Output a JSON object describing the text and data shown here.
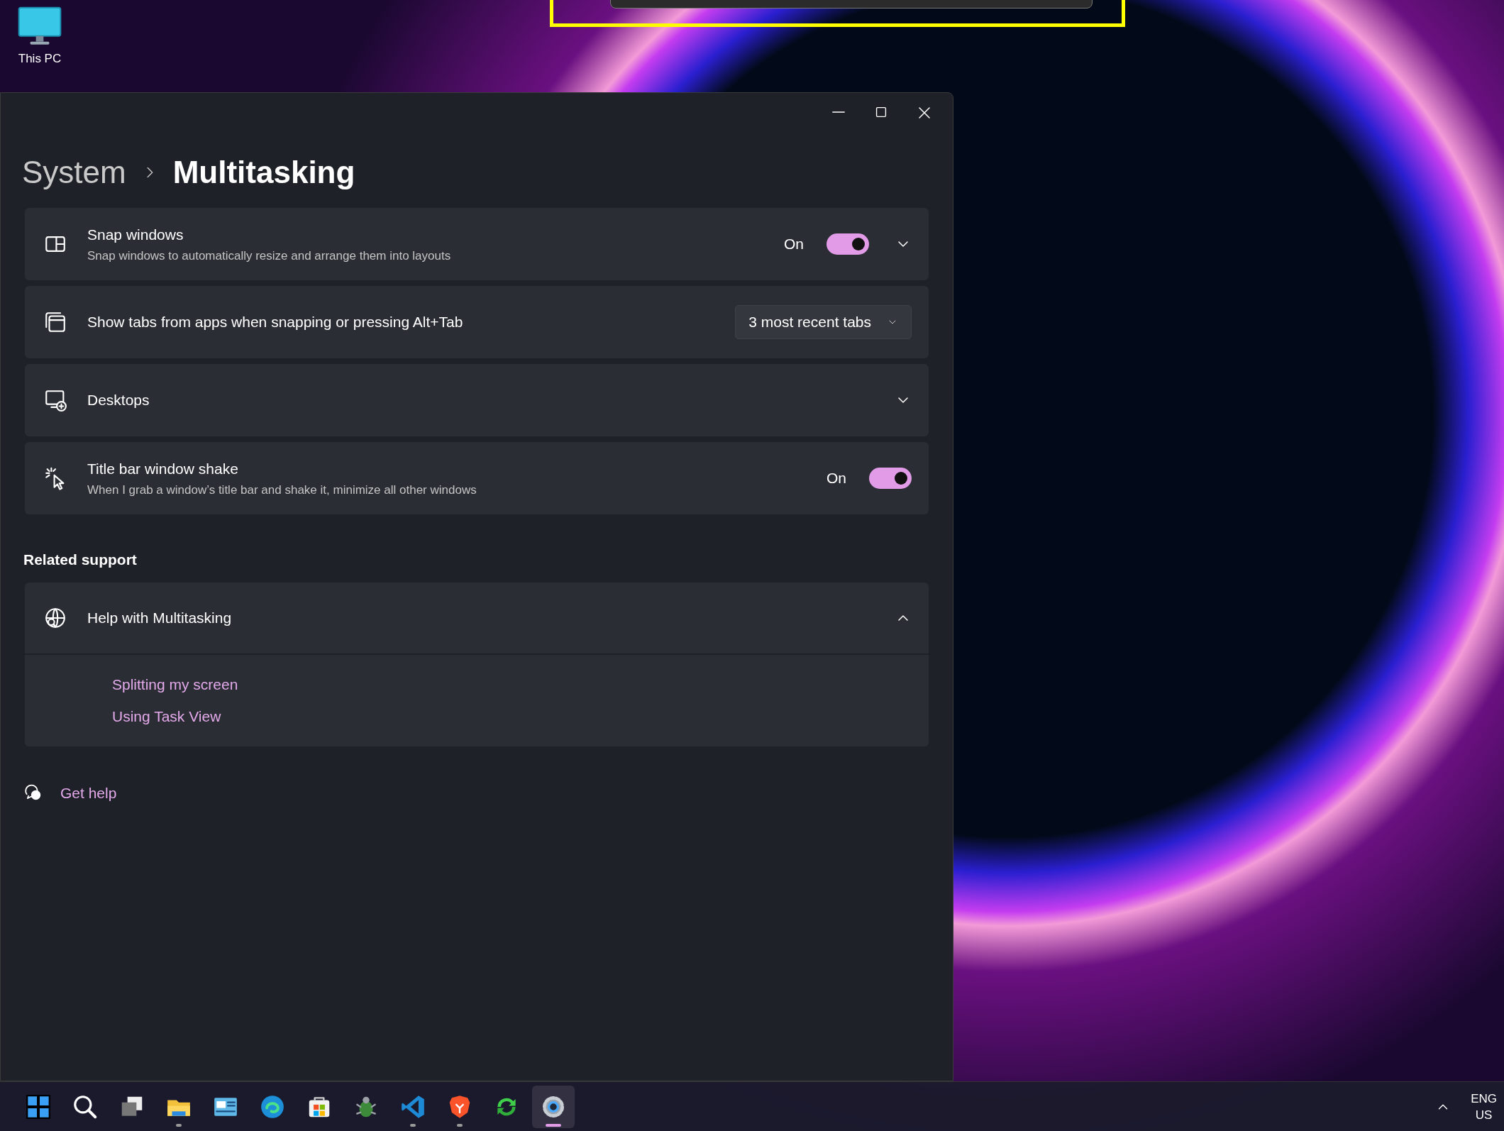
{
  "desktop": {
    "icons": [
      {
        "label": "This PC"
      }
    ]
  },
  "window": {
    "breadcrumb": {
      "parent": "System",
      "current": "Multitasking"
    },
    "settings": [
      {
        "kind": "toggle",
        "title": "Snap windows",
        "description": "Snap windows to automatically resize and arrange them into layouts",
        "state_label": "On",
        "on": true,
        "expandable": true
      },
      {
        "kind": "dropdown",
        "title": "Show tabs from apps when snapping or pressing Alt+Tab",
        "value": "3 most recent tabs"
      },
      {
        "kind": "expander",
        "title": "Desktops",
        "expanded": false
      },
      {
        "kind": "toggle",
        "title": "Title bar window shake",
        "description": "When I grab a window’s title bar and shake it, minimize all other windows",
        "state_label": "On",
        "on": true,
        "expandable": false
      }
    ],
    "related_support": {
      "heading": "Related support",
      "title": "Help with Multitasking",
      "expanded": true,
      "links": [
        "Splitting my screen",
        "Using Task View"
      ]
    },
    "get_help": "Get help"
  },
  "taskbar": {
    "apps": [
      {
        "kind": "start",
        "running": false,
        "selected": false
      },
      {
        "kind": "search",
        "running": false,
        "selected": false
      },
      {
        "kind": "taskview",
        "running": false,
        "selected": false
      },
      {
        "kind": "explorer",
        "running": true,
        "selected": false
      },
      {
        "kind": "panel",
        "running": false,
        "selected": false
      },
      {
        "kind": "edge",
        "running": false,
        "selected": false
      },
      {
        "kind": "store",
        "running": false,
        "selected": false
      },
      {
        "kind": "bug",
        "running": false,
        "selected": false
      },
      {
        "kind": "code",
        "running": true,
        "selected": false
      },
      {
        "kind": "brave",
        "running": true,
        "selected": false
      },
      {
        "kind": "sync",
        "running": false,
        "selected": false
      },
      {
        "kind": "settings",
        "running": true,
        "selected": true
      }
    ],
    "language": "ENG",
    "region": "US"
  }
}
